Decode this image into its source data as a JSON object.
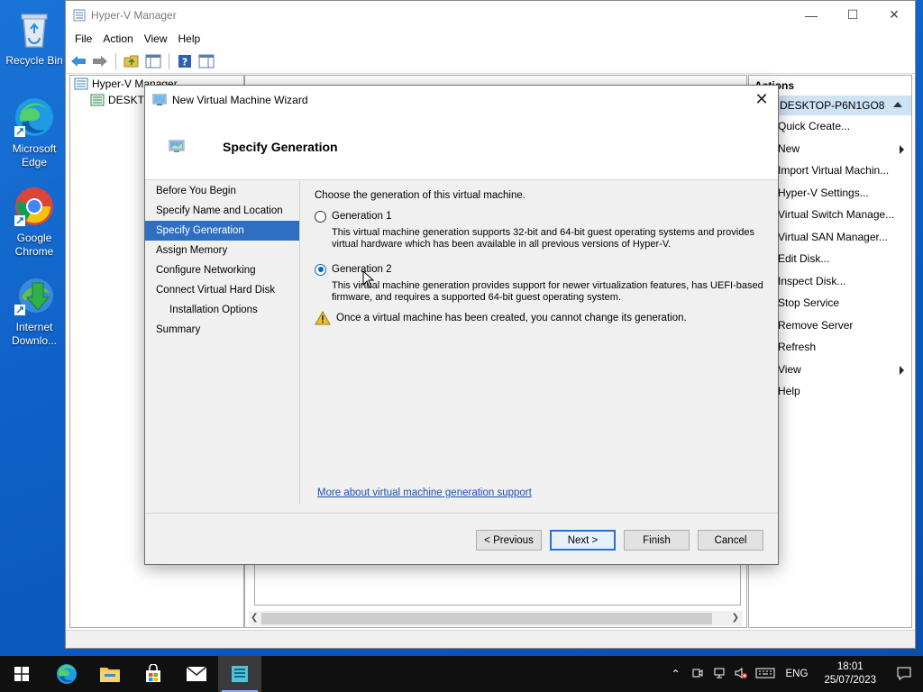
{
  "desktop": {
    "icons": [
      {
        "label": "Recycle Bin"
      },
      {
        "label": "Microsoft Edge"
      },
      {
        "label": "Google Chrome"
      },
      {
        "label": "Internet Downlo..."
      }
    ]
  },
  "hyperv": {
    "title": "Hyper-V Manager",
    "menu": [
      "File",
      "Action",
      "View",
      "Help"
    ],
    "tree": {
      "root": "Hyper-V Manager",
      "child": "DESKTOP-P6N1GO8"
    },
    "actions": {
      "header": "Actions",
      "group": "DESKTOP-P6N1GO8",
      "items": [
        {
          "label": "Quick Create...",
          "submenu": false
        },
        {
          "label": "New",
          "submenu": true
        },
        {
          "label": "Import Virtual Machin...",
          "submenu": false
        },
        {
          "label": "Hyper-V Settings...",
          "submenu": false
        },
        {
          "label": "Virtual Switch Manage...",
          "submenu": false
        },
        {
          "label": "Virtual SAN Manager...",
          "submenu": false
        },
        {
          "label": "Edit Disk...",
          "submenu": false
        },
        {
          "label": "Inspect Disk...",
          "submenu": false
        },
        {
          "label": "Stop Service",
          "submenu": false
        },
        {
          "label": "Remove Server",
          "submenu": false
        },
        {
          "label": "Refresh",
          "submenu": false
        },
        {
          "label": "View",
          "submenu": true
        },
        {
          "label": "Help",
          "submenu": false
        }
      ]
    }
  },
  "wizard": {
    "title": "New Virtual Machine Wizard",
    "heading": "Specify Generation",
    "steps": [
      {
        "label": "Before You Begin",
        "sub": false,
        "active": false
      },
      {
        "label": "Specify Name and Location",
        "sub": false,
        "active": false
      },
      {
        "label": "Specify Generation",
        "sub": false,
        "active": true
      },
      {
        "label": "Assign Memory",
        "sub": false,
        "active": false
      },
      {
        "label": "Configure Networking",
        "sub": false,
        "active": false
      },
      {
        "label": "Connect Virtual Hard Disk",
        "sub": false,
        "active": false
      },
      {
        "label": "Installation Options",
        "sub": true,
        "active": false
      },
      {
        "label": "Summary",
        "sub": false,
        "active": false
      }
    ],
    "prompt": "Choose the generation of this virtual machine.",
    "gen1": {
      "label": "Generation 1",
      "checked": false,
      "desc": "This virtual machine generation supports 32-bit and 64-bit guest operating systems and provides virtual hardware which has been available in all previous versions of Hyper-V."
    },
    "gen2": {
      "label": "Generation 2",
      "checked": true,
      "desc": "This virtual machine generation provides support for newer virtualization features, has UEFI-based firmware, and requires a supported 64-bit guest operating system."
    },
    "warning": "Once a virtual machine has been created, you cannot change its generation.",
    "link": "More about virtual machine generation support",
    "buttons": {
      "previous": "< Previous",
      "next": "Next >",
      "finish": "Finish",
      "cancel": "Cancel"
    }
  },
  "taskbar": {
    "lang": "ENG",
    "time": "18:01",
    "date": "25/07/2023"
  }
}
